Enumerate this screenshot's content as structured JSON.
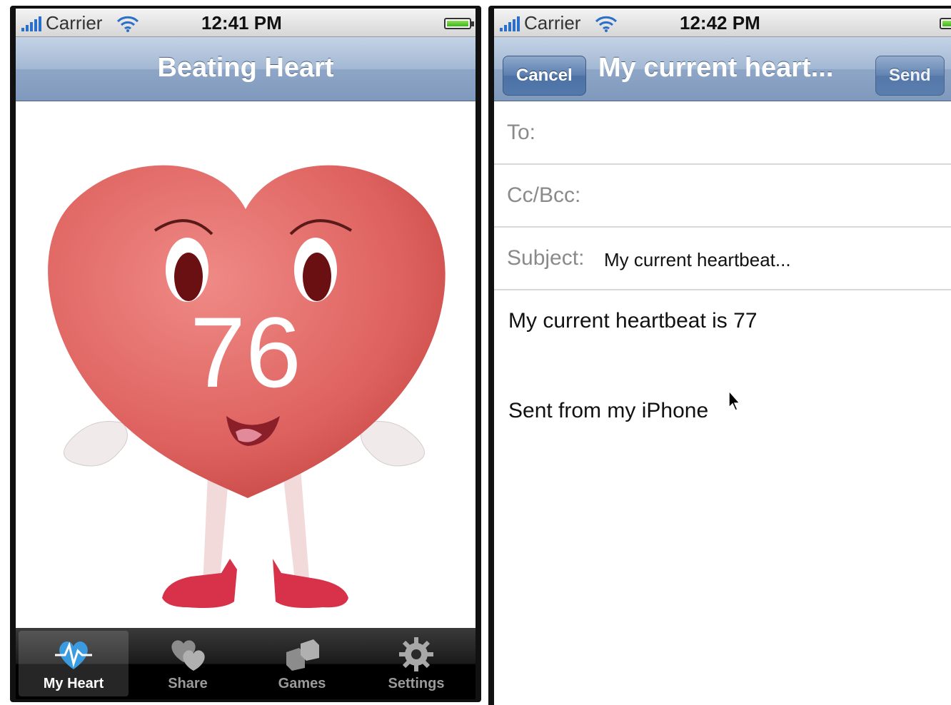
{
  "left_screen": {
    "status": {
      "carrier": "Carrier",
      "time": "12:41 PM"
    },
    "title": "Beating Heart",
    "bpm": "76",
    "tabs": [
      {
        "label": "My Heart",
        "icon": "heartbeat-icon",
        "active": true
      },
      {
        "label": "Share",
        "icon": "hearts-icon",
        "active": false
      },
      {
        "label": "Games",
        "icon": "cubes-icon",
        "active": false
      },
      {
        "label": "Settings",
        "icon": "gear-icon",
        "active": false
      }
    ]
  },
  "right_screen": {
    "status": {
      "carrier": "Carrier",
      "time": "12:42 PM"
    },
    "title": "My current heart...",
    "cancel_label": "Cancel",
    "send_label": "Send",
    "to_label": "To:",
    "cc_label": "Cc/Bcc:",
    "subject_label": "Subject:",
    "subject_value": "My current heartbeat...",
    "body_line1": "My current heartbeat is 77",
    "body_signature": "Sent from my iPhone"
  },
  "colors": {
    "nav_bar": "#8ea6c6",
    "heart": "#e0625f",
    "tab_bar": "#000000"
  }
}
